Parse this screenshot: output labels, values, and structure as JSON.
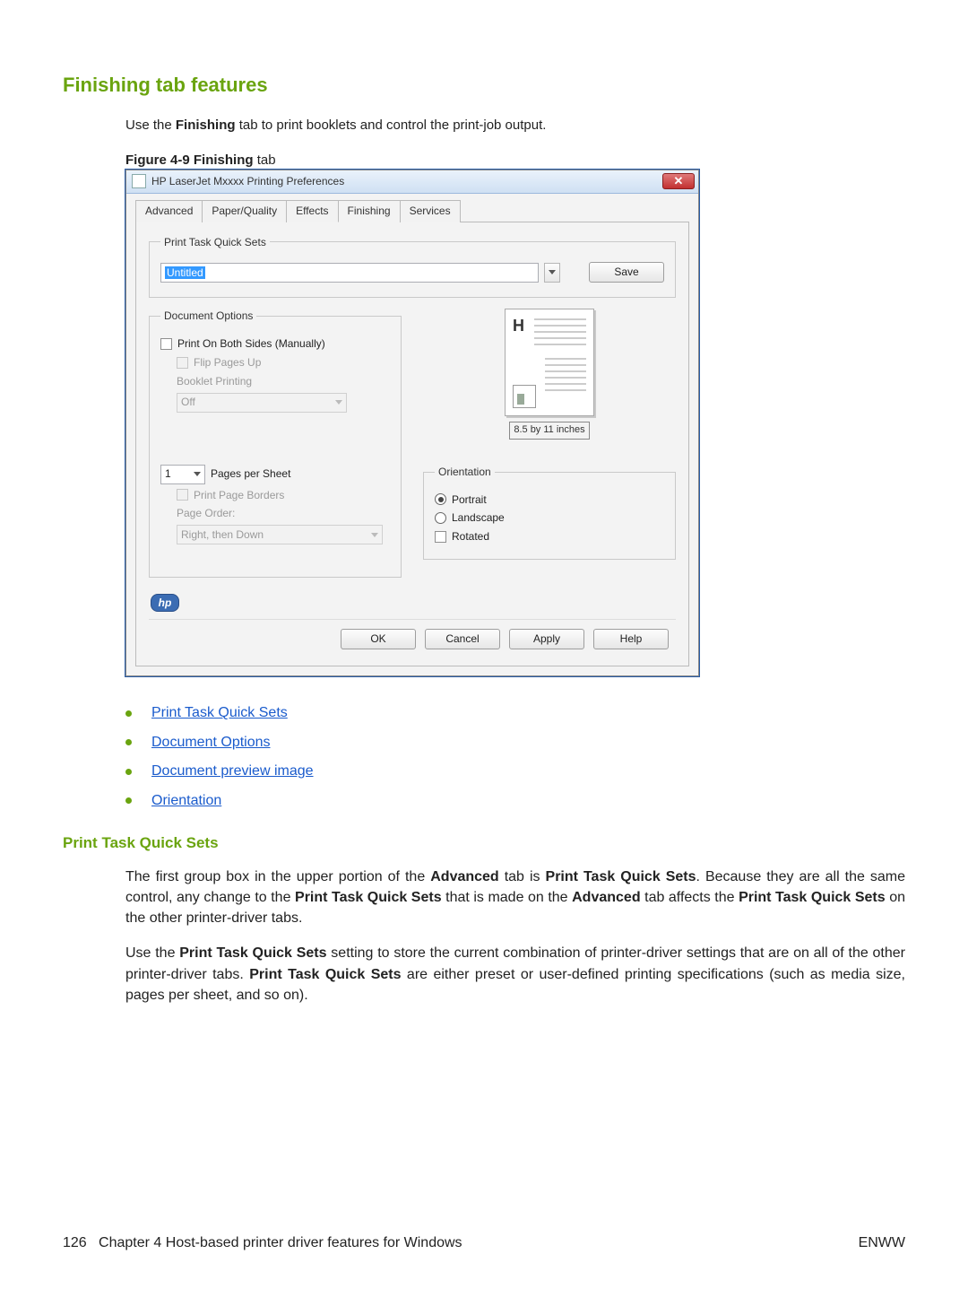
{
  "heading": "Finishing tab features",
  "intro_before": "Use the ",
  "intro_bold": "Finishing",
  "intro_after": " tab to print booklets and control the print-job output.",
  "figure_prefix": "Figure 4-9  ",
  "figure_bold": "Finishing",
  "figure_after": " tab",
  "dialog": {
    "title": "HP LaserJet Mxxxx Printing Preferences",
    "close_glyph": "✕",
    "tabs": [
      "Advanced",
      "Paper/Quality",
      "Effects",
      "Finishing",
      "Services"
    ],
    "active_tab_index": 3,
    "quicksets": {
      "legend": "Print Task Quick Sets",
      "value": "Untitled",
      "save": "Save"
    },
    "docopt": {
      "legend": "Document Options",
      "both_sides": "Print On Both Sides (Manually)",
      "flip": "Flip Pages Up",
      "booklet": "Booklet Printing",
      "booklet_value": "Off",
      "pps_value": "1",
      "pps_label": "Pages per Sheet",
      "borders": "Print Page Borders",
      "order_label": "Page Order:",
      "order_value": "Right, then Down"
    },
    "preview_size": "8.5 by 11 inches",
    "orientation": {
      "legend": "Orientation",
      "portrait": "Portrait",
      "landscape": "Landscape",
      "rotated": "Rotated"
    },
    "hp_logo": "hp",
    "buttons": {
      "ok": "OK",
      "cancel": "Cancel",
      "apply": "Apply",
      "help": "Help"
    }
  },
  "links": [
    "Print Task Quick Sets",
    "Document Options",
    "Document preview image",
    "Orientation"
  ],
  "subheading": "Print Task Quick Sets",
  "para1": {
    "a": "The first group box in the upper portion of the ",
    "b1": "Advanced",
    "b": " tab is ",
    "b2": "Print Task Quick Sets",
    "c": ". Because they are all the same control, any change to the ",
    "b3": "Print Task Quick Sets",
    "d": " that is made on the ",
    "b4": "Advanced",
    "e": " tab affects the ",
    "b5": "Print Task Quick Sets",
    "f": " on the other printer-driver tabs."
  },
  "para2": {
    "a": "Use the ",
    "b1": "Print Task Quick Sets",
    "b": " setting to store the current combination of printer-driver settings that are on all of the other printer-driver tabs. ",
    "b2": "Print Task Quick Sets",
    "c": " are either preset or user-defined printing specifications (such as media size, pages per sheet, and so on)."
  },
  "footer": {
    "page": "126",
    "chapter": "Chapter 4   Host-based printer driver features for Windows",
    "right": "ENWW"
  }
}
